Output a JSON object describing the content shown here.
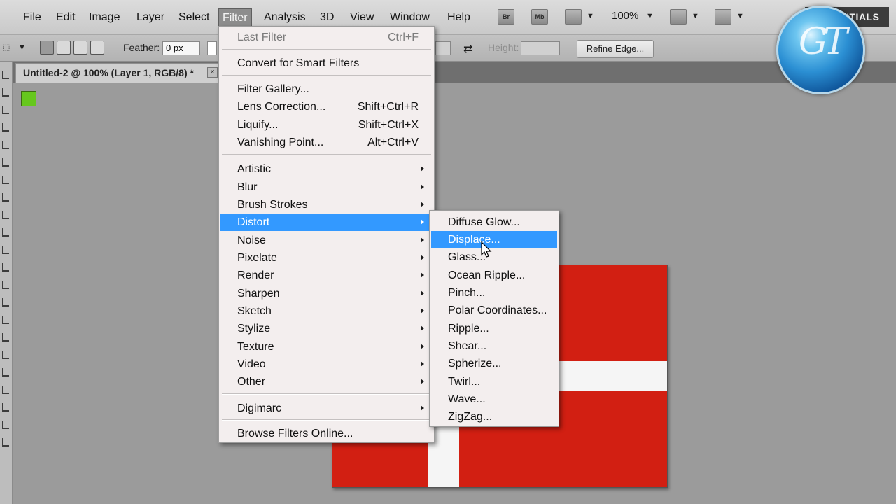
{
  "menubar": {
    "items": [
      "File",
      "Edit",
      "Image",
      "Layer",
      "Select",
      "Filter",
      "Analysis",
      "3D",
      "View",
      "Window",
      "Help"
    ],
    "active": "Filter",
    "bridge_icon": "Br",
    "minibridge_icon": "Mb",
    "zoom": "100%",
    "workspace": "ESSENTIALS"
  },
  "options": {
    "feather_label": "Feather:",
    "feather_value": "0 px",
    "height_label": "Height:",
    "refine_edge": "Refine Edge..."
  },
  "document": {
    "tab_title": "Untitled-2 @ 100% (Layer 1, RGB/8) *",
    "close": "×"
  },
  "logo": {
    "text": "GT"
  },
  "colors": {
    "canvas": "#d21f12",
    "stripe": "#f5f5f5",
    "highlight": "#3399ff",
    "foreground": "#66c71d"
  },
  "filter_menu": {
    "last_filter": {
      "label": "Last Filter",
      "shortcut": "Ctrl+F"
    },
    "convert": "Convert for Smart Filters",
    "gallery": "Filter Gallery...",
    "lens": {
      "label": "Lens Correction...",
      "shortcut": "Shift+Ctrl+R"
    },
    "liquify": {
      "label": "Liquify...",
      "shortcut": "Shift+Ctrl+X"
    },
    "vanishing": {
      "label": "Vanishing Point...",
      "shortcut": "Alt+Ctrl+V"
    },
    "categories": [
      "Artistic",
      "Blur",
      "Brush Strokes",
      "Distort",
      "Noise",
      "Pixelate",
      "Render",
      "Sharpen",
      "Sketch",
      "Stylize",
      "Texture",
      "Video",
      "Other"
    ],
    "digimarc": "Digimarc",
    "browse": "Browse Filters Online..."
  },
  "distort_menu": {
    "items": [
      "Diffuse Glow...",
      "Displace...",
      "Glass...",
      "Ocean Ripple...",
      "Pinch...",
      "Polar Coordinates...",
      "Ripple...",
      "Shear...",
      "Spherize...",
      "Twirl...",
      "Wave...",
      "ZigZag..."
    ],
    "highlighted": "Displace..."
  }
}
